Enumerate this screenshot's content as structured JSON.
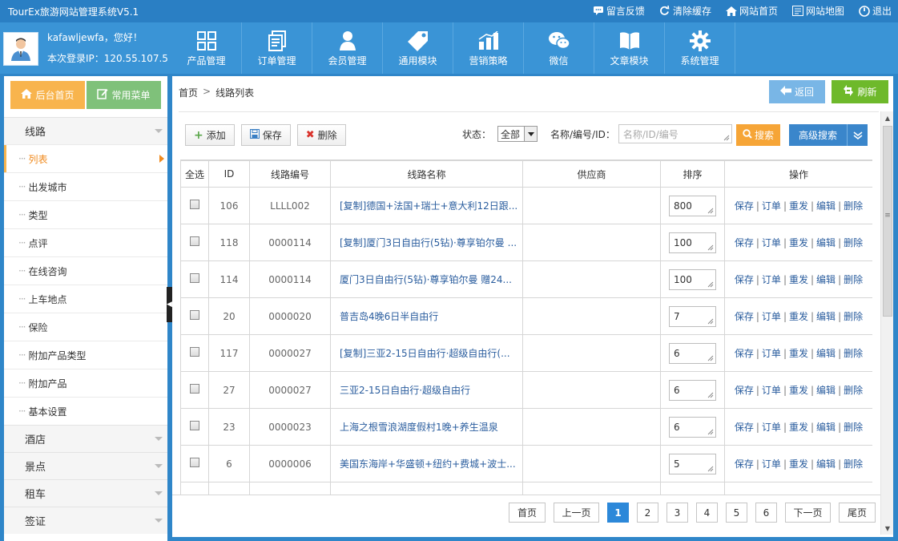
{
  "app_title": "TourEx旅游网站管理系统V5.1",
  "top_links": [
    {
      "label": "留言反馈",
      "icon": "message-icon"
    },
    {
      "label": "清除缓存",
      "icon": "refresh-icon"
    },
    {
      "label": "网站首页",
      "icon": "home-icon"
    },
    {
      "label": "网站地图",
      "icon": "sitemap-icon"
    },
    {
      "label": "退出",
      "icon": "power-icon"
    }
  ],
  "user": {
    "greeting": "kafawljewfa，您好！",
    "login_ip": "本次登录IP：120.55.107.5"
  },
  "nav": [
    {
      "label": "产品管理",
      "icon": "grid-icon"
    },
    {
      "label": "订单管理",
      "icon": "document-icon"
    },
    {
      "label": "会员管理",
      "icon": "member-icon"
    },
    {
      "label": "通用模块",
      "icon": "tag-icon"
    },
    {
      "label": "营销策略",
      "icon": "bar-chart-icon"
    },
    {
      "label": "微信",
      "icon": "wechat-icon"
    },
    {
      "label": "文章模块",
      "icon": "book-icon"
    },
    {
      "label": "系统管理",
      "icon": "gear-icon"
    }
  ],
  "sidebar": {
    "home_tab": "后台首页",
    "common_tab": "常用菜单",
    "groups_top": {
      "label": "线路"
    },
    "items": [
      "列表",
      "出发城市",
      "类型",
      "点评",
      "在线咨询",
      "上车地点",
      "保险",
      "附加产品类型",
      "附加产品",
      "基本设置"
    ],
    "active_item": "列表",
    "groups_bottom": [
      "酒店",
      "景点",
      "租车",
      "签证"
    ]
  },
  "breadcrumb": {
    "home": "首页",
    "sep": ">",
    "current": "线路列表"
  },
  "buttons": {
    "back": "返回",
    "refresh": "刷新",
    "add": "添加",
    "save": "保存",
    "delete": "删除",
    "search": "搜索",
    "advanced": "高级搜索"
  },
  "filter": {
    "status_label": "状态：",
    "status_value": "全部",
    "name_label": "名称/编号/ID：",
    "name_placeholder": "名称/ID/编号"
  },
  "table": {
    "headers": [
      "全选",
      "ID",
      "线路编号",
      "线路名称",
      "供应商",
      "排序",
      "操作"
    ],
    "ops": [
      "保存",
      "订单",
      "重发",
      "编辑",
      "删除"
    ],
    "rows": [
      {
        "id": "106",
        "code": "LLLL002",
        "name": "[复制]德国+法国+瑞士+意大利12日跟...",
        "supplier": "",
        "sort": "800"
      },
      {
        "id": "118",
        "code": "0000114",
        "name": "[复制]厦门3日自由行(5钻)·尊享铂尔曼 ...",
        "supplier": "",
        "sort": "100"
      },
      {
        "id": "114",
        "code": "0000114",
        "name": "厦门3日自由行(5钻)·尊享铂尔曼 赠24...",
        "supplier": "",
        "sort": "100"
      },
      {
        "id": "20",
        "code": "0000020",
        "name": "普吉岛4晚6日半自由行",
        "supplier": "",
        "sort": "7"
      },
      {
        "id": "117",
        "code": "0000027",
        "name": "[复制]三亚2-15日自由行·超级自由行(...",
        "supplier": "",
        "sort": "6"
      },
      {
        "id": "27",
        "code": "0000027",
        "name": "三亚2-15日自由行·超级自由行",
        "supplier": "",
        "sort": "6"
      },
      {
        "id": "23",
        "code": "0000023",
        "name": "上海之根雪浪湖度假村1晚+养生温泉",
        "supplier": "",
        "sort": "6"
      },
      {
        "id": "6",
        "code": "0000006",
        "name": "美国东海岸+华盛顿+纽约+费城+波士...",
        "supplier": "",
        "sort": "5"
      },
      {
        "id": "",
        "code": "",
        "name": "",
        "supplier": "",
        "sort": ""
      }
    ]
  },
  "pager": {
    "first": "首页",
    "prev": "上一页",
    "pages": [
      "1",
      "2",
      "3",
      "4",
      "5",
      "6"
    ],
    "current": "1",
    "next": "下一页",
    "last": "尾页"
  },
  "colors": {
    "header_bg": "#3a94d6",
    "topbar_bg": "#2a7fc4",
    "home_tab": "#f8b44d",
    "common_tab": "#7fc17a",
    "search_btn": "#f6a537",
    "adv_btn": "#3a86cb",
    "refresh_btn": "#6eb92b",
    "back_btn": "#79b6e6",
    "link": "#2a5d9e"
  }
}
